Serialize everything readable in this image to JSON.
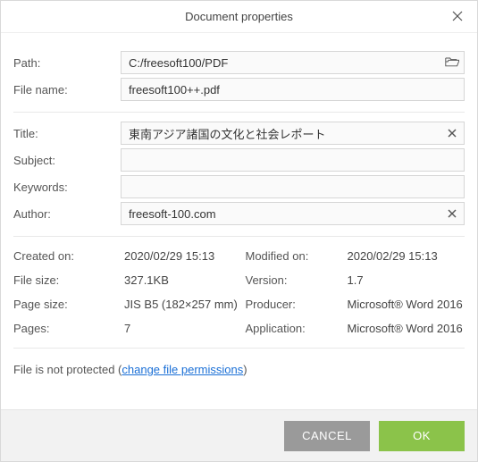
{
  "window": {
    "title": "Document properties"
  },
  "file": {
    "path_label": "Path:",
    "path_value": "C:/freesoft100/PDF",
    "name_label": "File name:",
    "name_value": "freesoft100++.pdf"
  },
  "doc": {
    "title_label": "Title:",
    "title_value": "東南アジア諸国の文化と社会レポート",
    "subject_label": "Subject:",
    "subject_value": "",
    "keywords_label": "Keywords:",
    "keywords_value": "",
    "author_label": "Author:",
    "author_value": "freesoft-100.com"
  },
  "meta": {
    "created_label": "Created on:",
    "created_value": "2020/02/29 15:13",
    "modified_label": "Modified on:",
    "modified_value": "2020/02/29 15:13",
    "filesize_label": "File size:",
    "filesize_value": "327.1KB",
    "version_label": "Version:",
    "version_value": "1.7",
    "pagesize_label": "Page size:",
    "pagesize_value": "JIS B5 (182×257 mm)",
    "producer_label": "Producer:",
    "producer_value": "Microsoft® Word 2016",
    "pages_label": "Pages:",
    "pages_value": "7",
    "application_label": "Application:",
    "application_value": "Microsoft® Word 2016"
  },
  "protect": {
    "prefix": "File is not protected (",
    "link": "change file permissions",
    "suffix": ")"
  },
  "buttons": {
    "cancel": "CANCEL",
    "ok": "OK"
  }
}
